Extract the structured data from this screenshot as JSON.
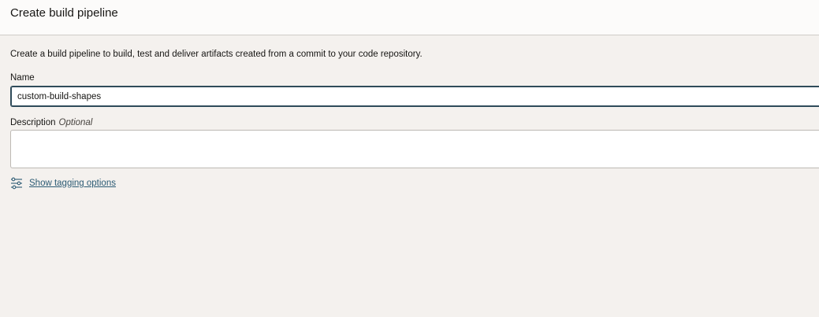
{
  "header": {
    "title": "Create build pipeline"
  },
  "form": {
    "intro": "Create a build pipeline to build, test and deliver artifacts created from a commit to your code repository.",
    "name_label": "Name",
    "name_value": "custom-build-shapes",
    "description_label": "Description",
    "description_optional": "Optional",
    "description_value": "",
    "tagging_link": "Show tagging options"
  },
  "colors": {
    "link": "#2c5b74",
    "focus_border": "#2f4b5a",
    "background": "#f4f1ee"
  },
  "icons": {
    "tagging": "sliders-icon"
  }
}
